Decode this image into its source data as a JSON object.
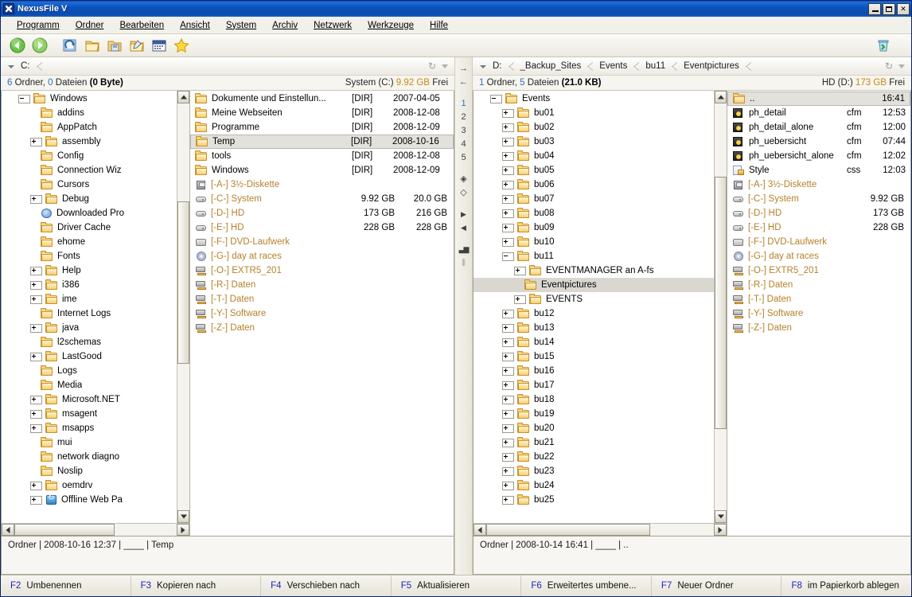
{
  "window": {
    "title": "NexusFile V",
    "minimize_label": "_",
    "maximize_label": "❐",
    "close_label": "✕"
  },
  "menu": [
    {
      "label": "Programm"
    },
    {
      "label": "Ordner"
    },
    {
      "label": "Bearbeiten"
    },
    {
      "label": "Ansicht"
    },
    {
      "label": "System"
    },
    {
      "label": "Archiv"
    },
    {
      "label": "Netzwerk"
    },
    {
      "label": "Werkzeuge"
    },
    {
      "label": "Hilfe"
    }
  ],
  "toolbar": {
    "icons": [
      {
        "name": "back-icon",
        "title": "Zurück"
      },
      {
        "name": "forward-icon",
        "title": "Vorwärts"
      },
      {
        "name": "refresh-view-icon",
        "title": "Ansicht"
      },
      {
        "name": "folder-open-icon",
        "title": "Ordner"
      },
      {
        "name": "folder-save-icon",
        "title": "Speichern"
      },
      {
        "name": "folder-edit-icon",
        "title": "Bearbeiten"
      },
      {
        "name": "calendar-icon",
        "title": "Kalender"
      },
      {
        "name": "favorites-star-icon",
        "title": "Favoriten"
      }
    ],
    "trash_icon": "recycle-bin-icon"
  },
  "center_strip": {
    "items": [
      {
        "label": "→",
        "name": "copy-right-icon",
        "active": false
      },
      {
        "label": "←",
        "name": "copy-left-icon",
        "active": false
      },
      {
        "label": "1",
        "name": "tab-slot-1",
        "active": true
      },
      {
        "label": "2",
        "name": "tab-slot-2",
        "active": false
      },
      {
        "label": "3",
        "name": "tab-slot-3",
        "active": false
      },
      {
        "label": "4",
        "name": "tab-slot-4",
        "active": false
      },
      {
        "label": "5",
        "name": "tab-slot-5",
        "active": false
      },
      {
        "label": "◈",
        "name": "sync-filled-icon",
        "active": false
      },
      {
        "label": "◇",
        "name": "sync-outline-icon",
        "active": false
      },
      {
        "label": "▶",
        "name": "play-right-icon",
        "active": false
      },
      {
        "label": "◀",
        "name": "play-left-icon",
        "active": false
      },
      {
        "label": "▃▆",
        "name": "statistics-icon",
        "active": false
      },
      {
        "label": "⫼",
        "name": "split-columns-icon",
        "active": false
      }
    ]
  },
  "left_pane": {
    "address": {
      "crumbs": [
        "C:"
      ],
      "refresh_icon": "refresh-icon",
      "dropdown_icon": "chevron-down-icon"
    },
    "info": {
      "folders_count": "6",
      "folders_label": "Ordner,",
      "files_count": "0",
      "files_label": "Dateien",
      "size": "(0 Byte)",
      "volume": "System (C:)",
      "free_value": "9.92 GB",
      "free_label": "Frei"
    },
    "tree": [
      {
        "label": "Windows",
        "depth": 2,
        "toggle": "minus",
        "icon": "folder-icon"
      },
      {
        "label": "addins",
        "depth": 3,
        "toggle": "none",
        "icon": "folder-icon"
      },
      {
        "label": "AppPatch",
        "depth": 3,
        "toggle": "none",
        "icon": "folder-icon"
      },
      {
        "label": "assembly",
        "depth": 3,
        "toggle": "plus",
        "icon": "folder-icon"
      },
      {
        "label": "Config",
        "depth": 3,
        "toggle": "none",
        "icon": "folder-icon"
      },
      {
        "label": "Connection Wiz",
        "depth": 3,
        "toggle": "none",
        "icon": "folder-icon"
      },
      {
        "label": "Cursors",
        "depth": 3,
        "toggle": "none",
        "icon": "folder-icon"
      },
      {
        "label": "Debug",
        "depth": 3,
        "toggle": "plus",
        "icon": "folder-icon"
      },
      {
        "label": "Downloaded Pro",
        "depth": 3,
        "toggle": "none",
        "icon": "downloaded-programs-icon"
      },
      {
        "label": "Driver Cache",
        "depth": 3,
        "toggle": "none",
        "icon": "folder-icon"
      },
      {
        "label": "ehome",
        "depth": 3,
        "toggle": "none",
        "icon": "folder-icon"
      },
      {
        "label": "Fonts",
        "depth": 3,
        "toggle": "none",
        "icon": "folder-icon"
      },
      {
        "label": "Help",
        "depth": 3,
        "toggle": "plus",
        "icon": "folder-icon"
      },
      {
        "label": "i386",
        "depth": 3,
        "toggle": "plus",
        "icon": "folder-icon"
      },
      {
        "label": "ime",
        "depth": 3,
        "toggle": "plus",
        "icon": "folder-icon"
      },
      {
        "label": "Internet Logs",
        "depth": 3,
        "toggle": "none",
        "icon": "folder-icon"
      },
      {
        "label": "java",
        "depth": 3,
        "toggle": "plus",
        "icon": "folder-icon"
      },
      {
        "label": "l2schemas",
        "depth": 3,
        "toggle": "none",
        "icon": "folder-icon"
      },
      {
        "label": "LastGood",
        "depth": 3,
        "toggle": "plus",
        "icon": "folder-icon"
      },
      {
        "label": "Logs",
        "depth": 3,
        "toggle": "none",
        "icon": "folder-icon"
      },
      {
        "label": "Media",
        "depth": 3,
        "toggle": "none",
        "icon": "folder-icon"
      },
      {
        "label": "Microsoft.NET",
        "depth": 3,
        "toggle": "plus",
        "icon": "folder-icon"
      },
      {
        "label": "msagent",
        "depth": 3,
        "toggle": "plus",
        "icon": "folder-icon"
      },
      {
        "label": "msapps",
        "depth": 3,
        "toggle": "plus",
        "icon": "folder-icon"
      },
      {
        "label": "mui",
        "depth": 3,
        "toggle": "none",
        "icon": "folder-icon"
      },
      {
        "label": "network diagno",
        "depth": 3,
        "toggle": "none",
        "icon": "folder-icon"
      },
      {
        "label": "Noslip",
        "depth": 3,
        "toggle": "none",
        "icon": "folder-icon"
      },
      {
        "label": "oemdrv",
        "depth": 3,
        "toggle": "plus",
        "icon": "folder-icon"
      },
      {
        "label": "Offline Web Pa",
        "depth": 3,
        "toggle": "plus",
        "icon": "offline-pages-icon"
      }
    ],
    "files": [
      {
        "name": "Dokumente und Einstellun...",
        "icon": "folder-icon",
        "kind": "dir",
        "type": "[DIR]",
        "date": "2007-04-05",
        "selected": false
      },
      {
        "name": "Meine Webseiten",
        "icon": "folder-icon",
        "kind": "dir",
        "type": "[DIR]",
        "date": "2008-12-08",
        "selected": false
      },
      {
        "name": "Programme",
        "icon": "folder-icon",
        "kind": "dir",
        "type": "[DIR]",
        "date": "2008-12-09",
        "selected": false
      },
      {
        "name": "Temp",
        "icon": "folder-icon",
        "kind": "dir",
        "type": "[DIR]",
        "date": "2008-10-16",
        "selected": true
      },
      {
        "name": "tools",
        "icon": "folder-icon",
        "kind": "dir",
        "type": "[DIR]",
        "date": "2008-12-08",
        "selected": false
      },
      {
        "name": "Windows",
        "icon": "folder-icon",
        "kind": "dir",
        "type": "[DIR]",
        "date": "2008-12-09",
        "selected": false
      },
      {
        "name": "[-A-] 3½-Diskette",
        "icon": "floppy-drive-icon",
        "kind": "drive",
        "free": "",
        "total": "",
        "selected": false
      },
      {
        "name": "[-C-] System",
        "icon": "hard-drive-icon",
        "kind": "drive",
        "free": "9.92 GB",
        "total": "20.0 GB",
        "selected": false
      },
      {
        "name": "[-D-] HD",
        "icon": "hard-drive-icon",
        "kind": "drive",
        "free": "173 GB",
        "total": "216 GB",
        "selected": false
      },
      {
        "name": "[-E-] HD",
        "icon": "hard-drive-icon",
        "kind": "drive",
        "free": "228 GB",
        "total": "228 GB",
        "selected": false
      },
      {
        "name": "[-F-] DVD-Laufwerk",
        "icon": "dvd-drive-icon",
        "kind": "drive",
        "free": "",
        "total": "",
        "selected": false
      },
      {
        "name": "[-G-] day at races",
        "icon": "cd-drive-icon",
        "kind": "drive",
        "free": "",
        "total": "",
        "selected": false
      },
      {
        "name": "[-O-] EXTR5_201",
        "icon": "network-drive-icon",
        "kind": "drive",
        "free": "",
        "total": "",
        "selected": false
      },
      {
        "name": "[-R-] Daten",
        "icon": "network-drive-icon",
        "kind": "drive",
        "free": "",
        "total": "",
        "selected": false
      },
      {
        "name": "[-T-] Daten",
        "icon": "network-drive-icon",
        "kind": "drive",
        "free": "",
        "total": "",
        "selected": false
      },
      {
        "name": "[-Y-] Software",
        "icon": "network-drive-icon",
        "kind": "drive",
        "free": "",
        "total": "",
        "selected": false
      },
      {
        "name": "[-Z-] Daten",
        "icon": "network-drive-icon",
        "kind": "drive",
        "free": "",
        "total": "",
        "selected": false
      }
    ],
    "status": "Ordner | 2008-10-16 12:37 | ____ | Temp"
  },
  "right_pane": {
    "address": {
      "crumbs": [
        "D:",
        "_Backup_Sites",
        "Events",
        "bu11",
        "Eventpictures"
      ],
      "refresh_icon": "refresh-icon",
      "dropdown_icon": "chevron-down-icon"
    },
    "info": {
      "folders_count": "1",
      "folders_label": "Ordner,",
      "files_count": "5",
      "files_label": "Dateien",
      "size": "(21.0 KB)",
      "volume": "HD (D:)",
      "free_value": "173 GB",
      "free_label": "Frei"
    },
    "tree": [
      {
        "label": "Events",
        "depth": 2,
        "toggle": "minus",
        "icon": "folder-icon",
        "selected": false
      },
      {
        "label": "bu01",
        "depth": 3,
        "toggle": "plus",
        "icon": "folder-icon",
        "selected": false
      },
      {
        "label": "bu02",
        "depth": 3,
        "toggle": "plus",
        "icon": "folder-icon",
        "selected": false
      },
      {
        "label": "bu03",
        "depth": 3,
        "toggle": "plus",
        "icon": "folder-icon",
        "selected": false
      },
      {
        "label": "bu04",
        "depth": 3,
        "toggle": "plus",
        "icon": "folder-icon",
        "selected": false
      },
      {
        "label": "bu05",
        "depth": 3,
        "toggle": "plus",
        "icon": "folder-icon",
        "selected": false
      },
      {
        "label": "bu06",
        "depth": 3,
        "toggle": "plus",
        "icon": "folder-icon",
        "selected": false
      },
      {
        "label": "bu07",
        "depth": 3,
        "toggle": "plus",
        "icon": "folder-icon",
        "selected": false
      },
      {
        "label": "bu08",
        "depth": 3,
        "toggle": "plus",
        "icon": "folder-icon",
        "selected": false
      },
      {
        "label": "bu09",
        "depth": 3,
        "toggle": "plus",
        "icon": "folder-icon",
        "selected": false
      },
      {
        "label": "bu10",
        "depth": 3,
        "toggle": "plus",
        "icon": "folder-icon",
        "selected": false
      },
      {
        "label": "bu11",
        "depth": 3,
        "toggle": "minus",
        "icon": "folder-icon",
        "selected": false
      },
      {
        "label": "EVENTMANAGER an A-fs",
        "depth": 4,
        "toggle": "plus",
        "icon": "folder-icon",
        "selected": false
      },
      {
        "label": "Eventpictures",
        "depth": 4,
        "toggle": "none",
        "icon": "folder-icon",
        "selected": true
      },
      {
        "label": "EVENTS",
        "depth": 4,
        "toggle": "plus",
        "icon": "folder-icon",
        "selected": false
      },
      {
        "label": "bu12",
        "depth": 3,
        "toggle": "plus",
        "icon": "folder-icon",
        "selected": false
      },
      {
        "label": "bu13",
        "depth": 3,
        "toggle": "plus",
        "icon": "folder-icon",
        "selected": false
      },
      {
        "label": "bu14",
        "depth": 3,
        "toggle": "plus",
        "icon": "folder-icon",
        "selected": false
      },
      {
        "label": "bu15",
        "depth": 3,
        "toggle": "plus",
        "icon": "folder-icon",
        "selected": false
      },
      {
        "label": "bu16",
        "depth": 3,
        "toggle": "plus",
        "icon": "folder-icon",
        "selected": false
      },
      {
        "label": "bu17",
        "depth": 3,
        "toggle": "plus",
        "icon": "folder-icon",
        "selected": false
      },
      {
        "label": "bu18",
        "depth": 3,
        "toggle": "plus",
        "icon": "folder-icon",
        "selected": false
      },
      {
        "label": "bu19",
        "depth": 3,
        "toggle": "plus",
        "icon": "folder-icon",
        "selected": false
      },
      {
        "label": "bu20",
        "depth": 3,
        "toggle": "plus",
        "icon": "folder-icon",
        "selected": false
      },
      {
        "label": "bu21",
        "depth": 3,
        "toggle": "plus",
        "icon": "folder-icon",
        "selected": false
      },
      {
        "label": "bu22",
        "depth": 3,
        "toggle": "plus",
        "icon": "folder-icon",
        "selected": false
      },
      {
        "label": "bu23",
        "depth": 3,
        "toggle": "plus",
        "icon": "folder-icon",
        "selected": false
      },
      {
        "label": "bu24",
        "depth": 3,
        "toggle": "plus",
        "icon": "folder-icon",
        "selected": false
      },
      {
        "label": "bu25",
        "depth": 3,
        "toggle": "plus",
        "icon": "folder-icon",
        "selected": false
      }
    ],
    "files": [
      {
        "name": "..",
        "icon": "folder-icon",
        "kind": "dir",
        "ext": "",
        "time": "16:41",
        "selected": true
      },
      {
        "name": "ph_detail",
        "icon": "cfm-file-icon",
        "kind": "file",
        "ext": "cfm",
        "time": "12:53",
        "selected": false
      },
      {
        "name": "ph_detail_alone",
        "icon": "cfm-file-icon",
        "kind": "file",
        "ext": "cfm",
        "time": "12:00",
        "selected": false
      },
      {
        "name": "ph_uebersicht",
        "icon": "cfm-file-icon",
        "kind": "file",
        "ext": "cfm",
        "time": "07:44",
        "selected": false
      },
      {
        "name": "ph_uebersicht_alone",
        "icon": "cfm-file-icon",
        "kind": "file",
        "ext": "cfm",
        "time": "12:02",
        "selected": false
      },
      {
        "name": "Style",
        "icon": "css-file-icon",
        "kind": "file",
        "ext": "css",
        "time": "12:03",
        "selected": false
      },
      {
        "name": "[-A-] 3½-Diskette",
        "icon": "floppy-drive-icon",
        "kind": "drive",
        "free": "",
        "selected": false
      },
      {
        "name": "[-C-] System",
        "icon": "hard-drive-icon",
        "kind": "drive",
        "free": "9.92 GB",
        "selected": false
      },
      {
        "name": "[-D-] HD",
        "icon": "hard-drive-icon",
        "kind": "drive",
        "free": "173 GB",
        "selected": false
      },
      {
        "name": "[-E-] HD",
        "icon": "hard-drive-icon",
        "kind": "drive",
        "free": "228 GB",
        "selected": false
      },
      {
        "name": "[-F-] DVD-Laufwerk",
        "icon": "dvd-drive-icon",
        "kind": "drive",
        "free": "",
        "selected": false
      },
      {
        "name": "[-G-] day at races",
        "icon": "cd-drive-icon",
        "kind": "drive",
        "free": "",
        "selected": false
      },
      {
        "name": "[-O-] EXTR5_201",
        "icon": "network-drive-icon",
        "kind": "drive",
        "free": "",
        "selected": false
      },
      {
        "name": "[-R-] Daten",
        "icon": "network-drive-icon",
        "kind": "drive",
        "free": "",
        "selected": false
      },
      {
        "name": "[-T-] Daten",
        "icon": "network-drive-icon",
        "kind": "drive",
        "free": "",
        "selected": false
      },
      {
        "name": "[-Y-] Software",
        "icon": "network-drive-icon",
        "kind": "drive",
        "free": "",
        "selected": false
      },
      {
        "name": "[-Z-] Daten",
        "icon": "network-drive-icon",
        "kind": "drive",
        "free": "",
        "selected": false
      }
    ],
    "status": "Ordner | 2008-10-14 16:41 | ____ | .."
  },
  "function_bar": [
    {
      "key": "F2",
      "label": "Umbenennen"
    },
    {
      "key": "F3",
      "label": "Kopieren nach"
    },
    {
      "key": "F4",
      "label": "Verschieben nach"
    },
    {
      "key": "F5",
      "label": "Aktualisieren"
    },
    {
      "key": "F6",
      "label": "Erweitertes umbene..."
    },
    {
      "key": "F7",
      "label": "Neuer Ordner"
    },
    {
      "key": "F8",
      "label": "im Papierkorb ablegen"
    }
  ],
  "colors": {
    "titlebar": "#0b52bd",
    "accent_blue": "#2f6fc0",
    "drive_text": "#b5812a",
    "free_space": "#c58a12",
    "fnkey": "#2222bb"
  }
}
